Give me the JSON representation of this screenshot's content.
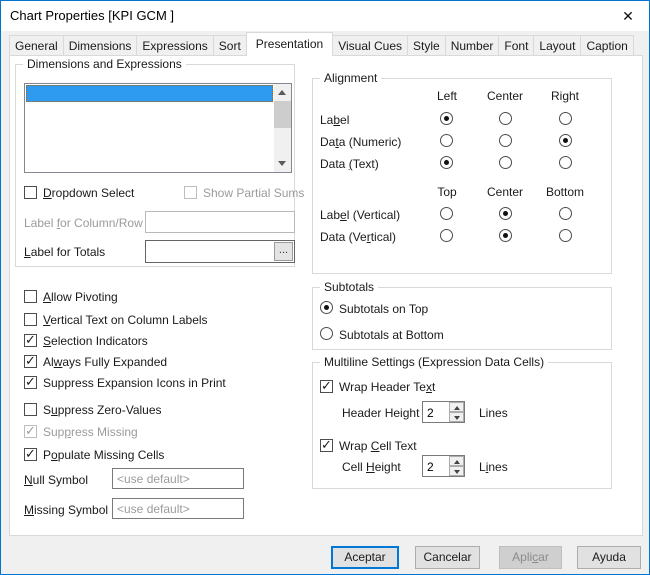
{
  "window": {
    "title": "Chart Properties [KPI GCM ]",
    "close_glyph": "✕"
  },
  "tabs": {
    "items": [
      "General",
      "Dimensions",
      "Expressions",
      "Sort",
      "Presentation",
      "Visual Cues",
      "Style",
      "Number",
      "Font",
      "Layout",
      "Caption"
    ],
    "active": "Presentation"
  },
  "dims_group": {
    "title": "Dimensions and Expressions",
    "list_items": [
      ""
    ],
    "selected_index": 0,
    "dropdown_select": {
      "label": {
        "text": "Dropdown Select",
        "accel": 0
      },
      "checked": false
    },
    "show_partial_sums": {
      "label": {
        "text": "Show Partial Sums"
      },
      "checked": false,
      "disabled": true
    },
    "label_for_column_row": {
      "label": {
        "text": "Label for Column/Row",
        "accel": 6
      },
      "value": "",
      "disabled": true
    },
    "label_for_totals": {
      "label": {
        "text": "Label for Totals",
        "accel": 0
      },
      "value": "",
      "browse_label": "..."
    }
  },
  "alignment": {
    "title": "Alignment",
    "h_headers": [
      "Left",
      "Center",
      "Right"
    ],
    "v_headers": [
      "Top",
      "Center",
      "Bottom"
    ],
    "rows_h": [
      {
        "label": {
          "text": "Label",
          "accel": 2
        },
        "selected": "Left",
        "cells": [
          true,
          false,
          false
        ]
      },
      {
        "label": {
          "text": "Data (Numeric)",
          "accel": 2
        },
        "selected": "Right",
        "cells": [
          false,
          false,
          true
        ]
      },
      {
        "label": {
          "text": "Data (Text)",
          "accel": 5
        },
        "selected": "Left",
        "cells": [
          true,
          false,
          false
        ]
      }
    ],
    "rows_v": [
      {
        "label": {
          "text": "Label (Vertical)",
          "accel": 3
        },
        "selected": "Center",
        "cells": [
          false,
          true,
          false
        ]
      },
      {
        "label": {
          "text": "Data (Vertical)",
          "accel": 8
        },
        "selected": "Center",
        "cells": [
          false,
          true,
          false
        ]
      }
    ]
  },
  "options": [
    {
      "label": {
        "text": "Allow Pivoting",
        "accel": 0
      },
      "checked": false
    },
    {
      "label": {
        "text": "Vertical Text on Column Labels",
        "accel": 0
      },
      "checked": false
    },
    {
      "label": {
        "text": "Selection Indicators",
        "accel": 0
      },
      "checked": true
    },
    {
      "label": {
        "text": "Always Fully Expanded",
        "accel": 2
      },
      "checked": true
    },
    {
      "label": {
        "text": "Suppress Expansion Icons in Print"
      },
      "checked": true
    },
    {
      "label": {
        "text": "Suppress Zero-Values",
        "accel": 1
      },
      "checked": false
    },
    {
      "label": {
        "text": "Suppress Missing",
        "accel": 3
      },
      "checked": true,
      "disabled": true
    },
    {
      "label": {
        "text": "Populate Missing Cells",
        "accel": 1
      },
      "checked": true
    }
  ],
  "symbols": {
    "null_symbol": {
      "label": {
        "text": "Null Symbol",
        "accel": 0
      },
      "value": "<use default>"
    },
    "missing_symbol": {
      "label": {
        "text": "Missing Symbol",
        "accel": 0
      },
      "value": "<use default>"
    }
  },
  "subtotals": {
    "title": "Subtotals",
    "options": [
      {
        "label": "Subtotals on Top",
        "selected": true
      },
      {
        "label": "Subtotals at Bottom",
        "selected": false
      }
    ]
  },
  "multiline": {
    "title": "Multiline Settings (Expression Data Cells)",
    "wrap_header": {
      "label": {
        "text": "Wrap Header Text",
        "accel": 14
      },
      "checked": true
    },
    "header_height": {
      "label": {
        "text": "Header Height",
        "accel": 10
      },
      "value": "2",
      "unit": {
        "text": "Lines"
      }
    },
    "wrap_cell": {
      "label": {
        "text": "Wrap Cell Text",
        "accel": 5
      },
      "checked": true
    },
    "cell_height": {
      "label": {
        "text": "Cell Height",
        "accel": 5
      },
      "value": "2",
      "unit": {
        "text": "Lines",
        "accel": 1
      }
    }
  },
  "buttons": [
    {
      "label": {
        "text": "Aceptar"
      },
      "default": true
    },
    {
      "label": {
        "text": "Cancelar"
      }
    },
    {
      "label": {
        "text": "Aplicar",
        "accel": 4
      },
      "disabled": true
    },
    {
      "label": {
        "text": "Ayuda"
      }
    }
  ],
  "colors": {
    "accent": "#0078d7",
    "selection": "#2e9bf0",
    "dialog_bg": "#f0f0f0"
  }
}
